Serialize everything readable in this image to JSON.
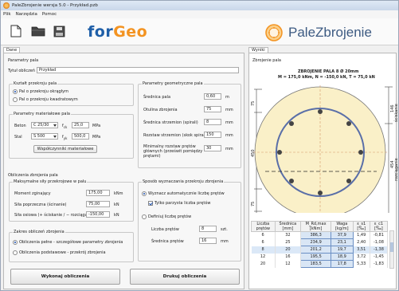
{
  "window": {
    "title": "PaleZbrojenie wersja 5.0 - Przykład.pzb"
  },
  "menu": [
    "Plik",
    "Narzędzia",
    "Pomoc"
  ],
  "toolbar": {
    "logo_for": "for",
    "logo_geo": "Geo",
    "brand": "PaleZbrojenie"
  },
  "left_tab": "Dane",
  "right_tab": "Wyniki",
  "params": {
    "group_title": "Parametry pala",
    "name_label": "Tytuł obliczeń",
    "name_value": "Przykład"
  },
  "shape": {
    "title": "Kształt przekroju pala",
    "opt_round": "Pal o przekroju okrągłym",
    "opt_square": "Pal o przekroju kwadratowym"
  },
  "geometry": {
    "title": "Parametry geometryczne pala",
    "rows": [
      {
        "label": "Średnica pala",
        "value": "0,60",
        "unit": "m"
      },
      {
        "label": "Otulina zbrojenia",
        "value": "75",
        "unit": "mm"
      },
      {
        "label": "Średnica strzemion (spirali)",
        "value": "8",
        "unit": "mm"
      },
      {
        "label": "Rozstaw strzemion (skok spirali)",
        "value": "150",
        "unit": "mm"
      }
    ],
    "min_label_1": "Minimalny rozstaw prętów",
    "min_label_2": "głównych (prześwit pomiędzy",
    "min_label_3": "prętami)",
    "min_value": "30",
    "min_unit": "mm"
  },
  "material": {
    "title": "Parametry materiałowe pala",
    "beton_label": "Beton",
    "beton_value": "C 25/30",
    "fck_symbol": "f",
    "fck_sub": "ck",
    "fck_value": "25,0",
    "fck_unit": "MPa",
    "stal_label": "Stal",
    "stal_value": "S 500",
    "fyk_symbol": "f",
    "fyk_sub": "yk",
    "fyk_value": "500,0",
    "fyk_unit": "MPa",
    "coef_button": "Współczynniki materiałowe"
  },
  "calc": {
    "group_title": "Obliczenia zbrojenia pala",
    "forces_title": "Maksymalne siły przekrojowe w palu",
    "forces": [
      {
        "label": "Moment zginający",
        "value": "175,00",
        "unit": "kNm"
      },
      {
        "label": "Siła poprzeczna (ścinanie)",
        "value": "75,00",
        "unit": "kN"
      },
      {
        "label": "Siła osiowa (+ ściskanie / − rozciąganie)",
        "value": "-150,00",
        "unit": "kN"
      }
    ],
    "scope_title": "Zakres obliczeń zbrojenia",
    "scope_opt1": "Obliczenia pełne - szczegółowe parametry zbrojenia",
    "scope_opt2": "Obliczenia podstawowe - przekrój zbrojenia",
    "method_title": "Sposób wyznaczania przekroju zbrojenia",
    "method_opt1": "Wyznacz automatycznie liczbę prętów",
    "method_chk": "Tylko parzysta liczba prętów",
    "method_opt2": "Definiuj liczbę prętów",
    "bars_label": "Liczba prętów",
    "bars_value": "8",
    "bars_unit": "szt.",
    "diam_label": "Średnica prętów",
    "diam_value": "16",
    "diam_unit": "mm"
  },
  "buttons": {
    "compute": "Wykonaj obliczenia",
    "print": "Drukuj obliczenia"
  },
  "results": {
    "section_title": "Zbrojenie pala",
    "drawing_title": "ZBROJENIE PALA 8 Ø 20mm",
    "drawing_sub": "M = 175,0 kNm, N = -150,0 kN, T = 75,0 kN",
    "dim_top_left": "75",
    "dim_mid_left": "450",
    "dim_bottom_left": "75",
    "dim_right_top_num": "146",
    "dim_right_top_txt": "ściskanie",
    "dim_right_bot_num": "454",
    "dim_right_bot_txt": "rozciąganie",
    "table_headers": [
      "Liczba prętów",
      "Średnica [mm]",
      "M_Rd,max [kNm]",
      "Waga [kg/m]",
      "ε_s1 [‰]",
      "ε_c1 [‰]"
    ],
    "rows": [
      [
        "6",
        "32",
        "386,3",
        "37,9",
        "1,49",
        "-0,81"
      ],
      [
        "6",
        "25",
        "234,9",
        "23,1",
        "2,40",
        "-1,08"
      ],
      [
        "8",
        "20",
        "201,2",
        "19,7",
        "3,51",
        "-1,38"
      ],
      [
        "12",
        "16",
        "195,5",
        "18,9",
        "3,72",
        "-1,45"
      ],
      [
        "20",
        "12",
        "183,5",
        "17,8",
        "5,33",
        "-1,83"
      ]
    ],
    "highlight_row": 2
  }
}
